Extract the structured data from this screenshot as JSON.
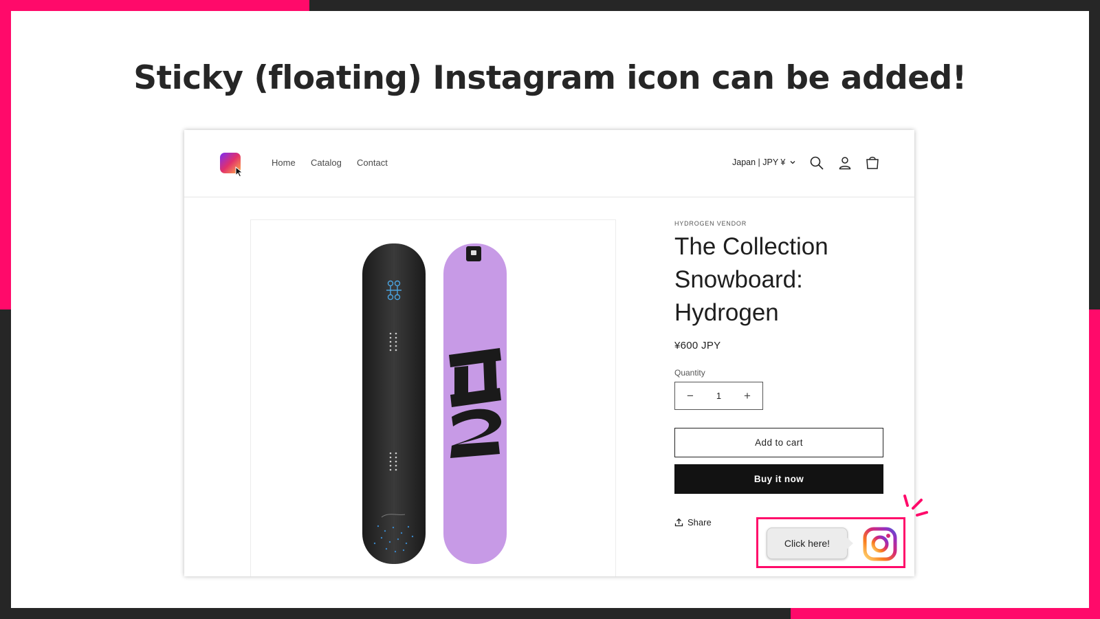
{
  "colors": {
    "accent": "#ff0a6a",
    "dark": "#262626",
    "board_purple": "#c79ae6"
  },
  "headline": "Sticky (floating) Instagram icon can be added!",
  "store": {
    "logo_icon": "instagram-gradient-logo",
    "nav": [
      "Home",
      "Catalog",
      "Contact"
    ],
    "locale": "Japan | JPY ¥",
    "header_icons": [
      "search-icon",
      "account-icon",
      "cart-icon"
    ]
  },
  "product": {
    "vendor": "HYDROGEN VENDOR",
    "title": "The Collection Snowboard: Hydrogen",
    "price": "¥600 JPY",
    "quantity_label": "Quantity",
    "quantity": "1",
    "add_to_cart": "Add to cart",
    "buy_now": "Buy it now",
    "share": "Share"
  },
  "floating": {
    "bubble_text": "Click here!",
    "icon": "instagram-icon"
  }
}
